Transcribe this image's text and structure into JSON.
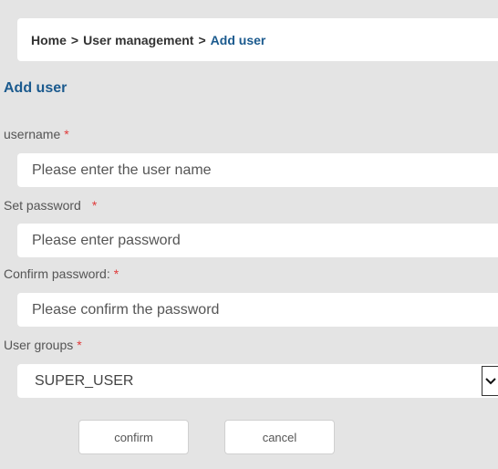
{
  "breadcrumb": {
    "home": "Home",
    "separator": ">",
    "section": "User management",
    "current": "Add user"
  },
  "page_title": "Add user",
  "form": {
    "username": {
      "label": "username",
      "required": "*",
      "placeholder": "Please enter the user name",
      "value": ""
    },
    "password": {
      "label": "Set password",
      "required": "*",
      "placeholder": "Please enter password",
      "value": ""
    },
    "confirm_password": {
      "label": "Confirm password:",
      "required": "*",
      "placeholder": "Please confirm the password",
      "value": ""
    },
    "user_groups": {
      "label": "User groups",
      "required": "*",
      "selected": "SUPER_USER"
    }
  },
  "buttons": {
    "confirm": "confirm",
    "cancel": "cancel"
  },
  "colors": {
    "accent": "#1b5a8e",
    "required": "#e03a3a",
    "background": "#e4e4e4"
  },
  "icons": {
    "select_arrow": "chevron-down-icon"
  }
}
